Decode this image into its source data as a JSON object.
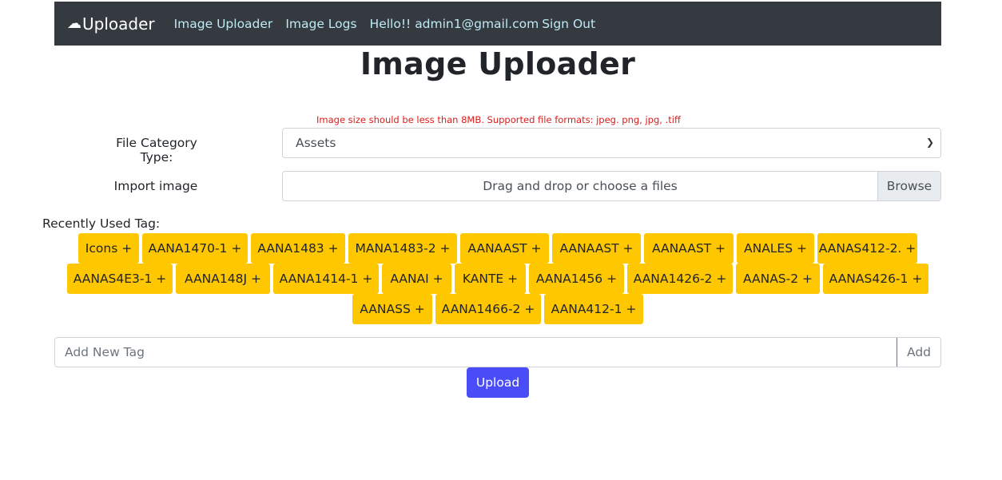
{
  "navbar": {
    "brand_icon": "cloud-icon",
    "brand": "Uploader",
    "links": [
      "Image Uploader",
      "Image Logs"
    ],
    "user": "Hello!! admin1@gmail.com",
    "signout": "Sign Out"
  },
  "page_title": "Image Uploader",
  "hint": "Image size should be less than 8MB. Supported file formats: jpeg. png, jpg, .tiff",
  "category": {
    "label": "File Category Type:",
    "selected": "Assets"
  },
  "import": {
    "label": "Import image",
    "dropzone": "Drag and drop or choose a files",
    "browse": "Browse"
  },
  "recent_label": "Recently Used Tag:",
  "tags": [
    "Icons +",
    "AANA1470-1 +",
    "AANA1483 +",
    "MANA1483-2 +",
    "AANAAST +",
    "AANAAST +",
    "AANAAST +",
    "ANALES +",
    "AANAS412-2. +",
    "AANAS4E3-1 +",
    "AANA148J +",
    "AANA1414-1 +",
    "AANAI +",
    "KANTE +",
    "AANA1456 +",
    "AANA1426-2 +",
    "AANAS-2 +",
    "AANAS426-1 +",
    "AANASS +",
    "AANA1466-2 +",
    "AANA412-1 +"
  ],
  "new_tag": {
    "placeholder": "Add New Tag",
    "button": "Add"
  },
  "upload": "Upload",
  "colors": {
    "navbar": "#343a40",
    "tag": "#ffc700",
    "upload": "#4a4cf8",
    "hint": "#dc1c1c"
  }
}
